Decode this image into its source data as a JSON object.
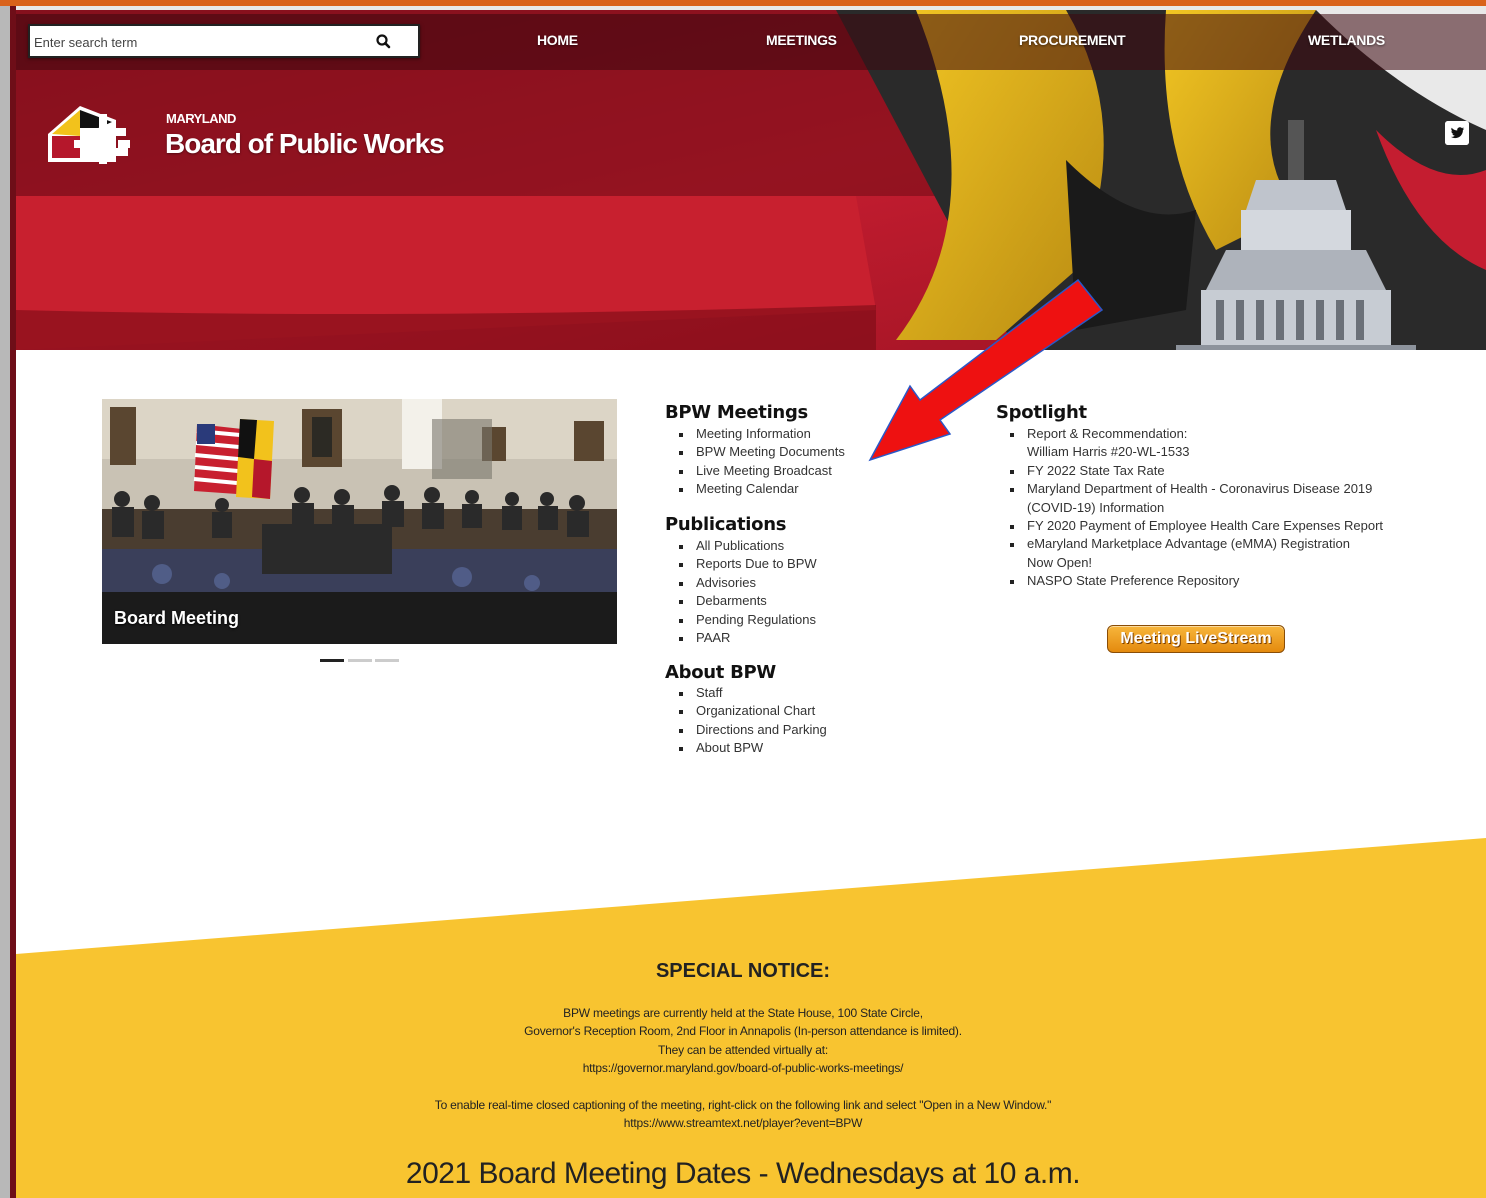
{
  "search": {
    "placeholder": "Enter search term"
  },
  "nav": {
    "home": "HOME",
    "meetings": "MEETINGS",
    "procurement": "PROCUREMENT",
    "wetlands": "WETLANDS"
  },
  "brand": {
    "small": "MARYLAND",
    "large": "Board of Public Works"
  },
  "carousel": {
    "caption": "Board Meeting",
    "slides": 3,
    "active": 1
  },
  "bpw_meetings": {
    "title": "BPW Meetings",
    "items": [
      "Meeting Information",
      "BPW Meeting Documents",
      "Live Meeting Broadcast",
      "Meeting Calendar"
    ]
  },
  "publications": {
    "title": "Publications",
    "items": [
      "All Publications",
      "Reports Due to BPW",
      "Advisories",
      "Debarments",
      "Pending Regulations",
      "PAAR"
    ]
  },
  "about": {
    "title": "About BPW",
    "items": [
      "Staff",
      "Organizational Chart",
      "Directions and Parking",
      "About BPW"
    ]
  },
  "spotlight": {
    "title": "Spotlight",
    "items": [
      [
        "Report & Recommendation:",
        "William Harris #20-WL-1533"
      ],
      [
        "FY 2022 State Tax Rate"
      ],
      [
        "Maryland Department of Health - Coronavirus Disease 2019",
        "(COVID-19) Information"
      ],
      [
        "FY 2020 Payment of Employee Health Care Expenses Report"
      ],
      [
        "eMaryland Marketplace Advantage (eMMA) Registration",
        "Now Open!"
      ],
      [
        "NASPO State Preference Repository"
      ]
    ]
  },
  "livestream": {
    "label": "Meeting LiveStream"
  },
  "notice": {
    "title": "SPECIAL NOTICE:",
    "line1": "BPW meetings are currently held at the State House, 100 State Circle,",
    "line2": "Governor's Reception Room, 2nd Floor in Annapolis (In-person attendance is limited).",
    "line3": "They can be attended virtually at:",
    "line4": "https://governor.maryland.gov/board-of-public-works-meetings/",
    "line5": "To enable real-time closed captioning of the meeting, right-click on the following link and select \"Open in a New Window.\"",
    "line6": "https://www.streamtext.net/player?event=BPW"
  },
  "dates_heading": "2021 Board Meeting Dates - Wednesdays at 10 a.m.",
  "colors": {
    "header_red": "#b41a2c",
    "nav_dark": "#5a0a14",
    "notice_yellow": "#f8c430",
    "livestream_orange": "#f0a020",
    "arrow_red": "#ee1111"
  },
  "icons": {
    "search": "search-icon",
    "twitter": "twitter-icon",
    "logo": "maryland-flag-logo"
  }
}
